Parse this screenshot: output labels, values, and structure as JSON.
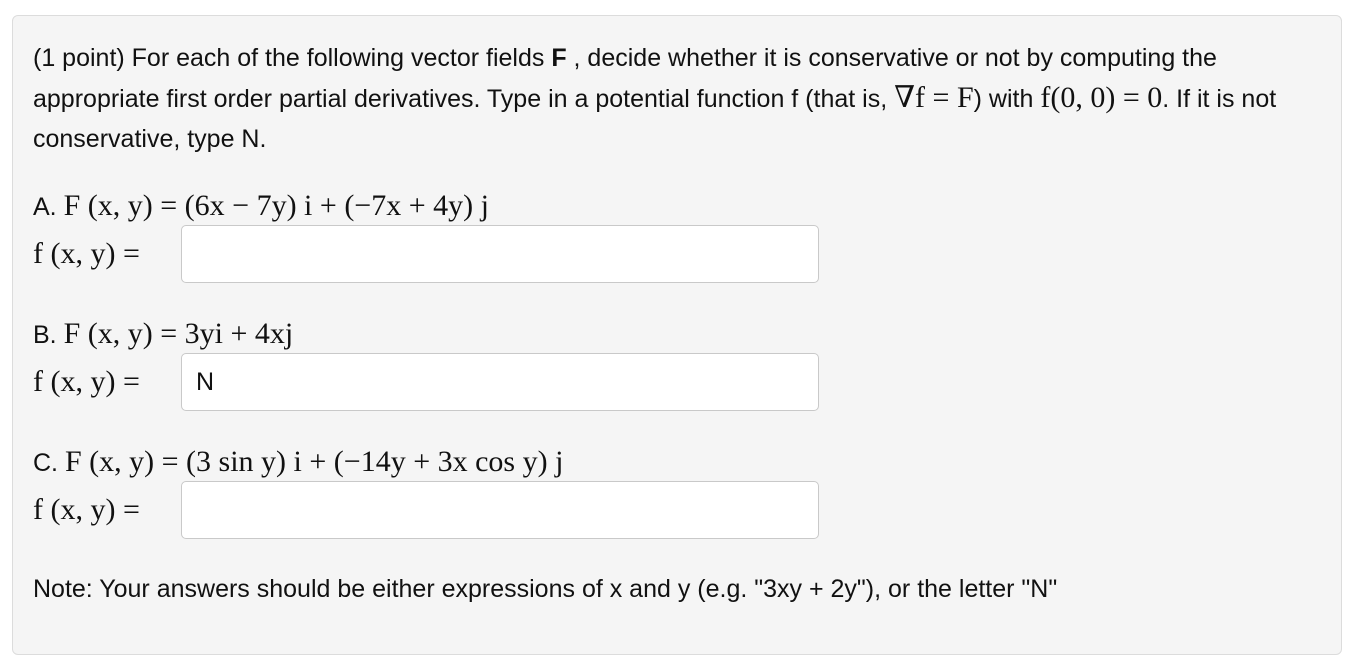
{
  "problem": {
    "intro_part1": "(1 point) For each of the following vector fields ",
    "intro_F": "F",
    "intro_part2": " , decide whether it is conservative or not by computing the appropriate first order partial derivatives. Type in a potential function f (that is, ",
    "intro_grad": "∇f = F",
    "intro_part3": ") with ",
    "intro_cond": "f(0, 0) = 0",
    "intro_part4": ". If it is not conservative, type N."
  },
  "parts": [
    {
      "label": "A.",
      "field": "F (x, y) = (6x − 7y) i + (−7x + 4y) j",
      "answer_label": "f (x, y) =",
      "value": ""
    },
    {
      "label": "B.",
      "field": "F (x, y) = 3yi + 4xj",
      "answer_label": "f (x, y) =",
      "value": "N"
    },
    {
      "label": "C.",
      "field": "F (x, y) = (3 sin y) i + (−14y + 3x cos y) j",
      "answer_label": "f (x, y) =",
      "value": ""
    }
  ],
  "note": "Note: Your answers should be either expressions of x and y (e.g. \"3xy + 2y\"), or the letter \"N\""
}
